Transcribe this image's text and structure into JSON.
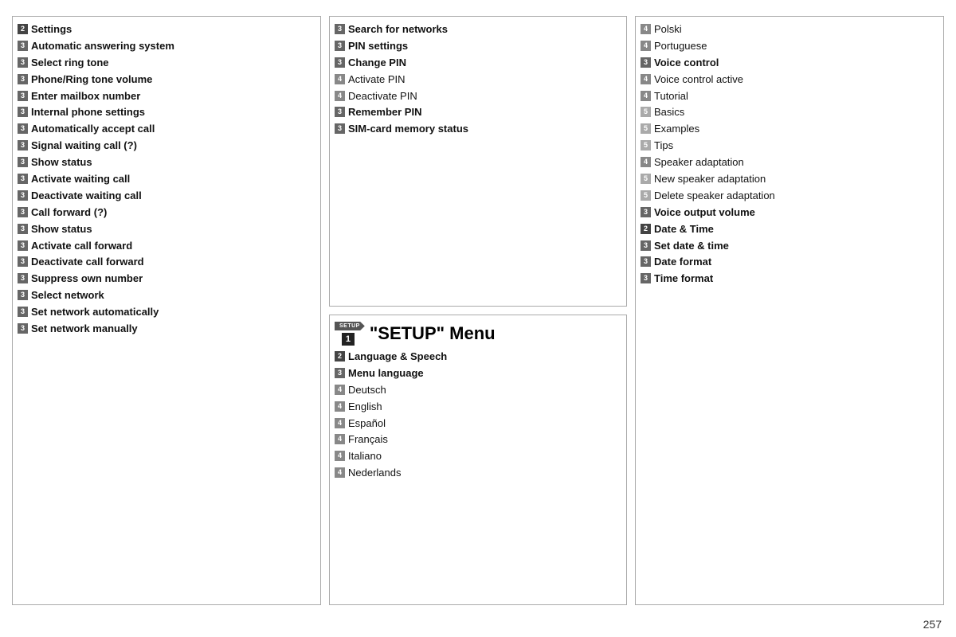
{
  "columns": {
    "left": {
      "items": [
        {
          "badge": "2",
          "level": 2,
          "text": "Settings",
          "bold": true
        },
        {
          "badge": "3",
          "level": 3,
          "text": "Automatic answering system",
          "bold": true
        },
        {
          "badge": "3",
          "level": 3,
          "text": "Select ring tone",
          "bold": true
        },
        {
          "badge": "3",
          "level": 3,
          "text": "Phone/Ring tone volume",
          "bold": true
        },
        {
          "badge": "3",
          "level": 3,
          "text": "Enter mailbox number",
          "bold": true
        },
        {
          "badge": "3",
          "level": 3,
          "text": "Internal phone settings",
          "bold": true
        },
        {
          "badge": "3",
          "level": 3,
          "text": "Automatically accept call",
          "bold": true
        },
        {
          "badge": "3",
          "level": 3,
          "text": "Signal waiting call (?)",
          "bold": true
        },
        {
          "badge": "3",
          "level": 3,
          "text": "Show status",
          "bold": true
        },
        {
          "badge": "3",
          "level": 3,
          "text": "Activate waiting call",
          "bold": true
        },
        {
          "badge": "3",
          "level": 3,
          "text": "Deactivate waiting call",
          "bold": true
        },
        {
          "badge": "3",
          "level": 3,
          "text": "Call forward (?)",
          "bold": true
        },
        {
          "badge": "3",
          "level": 3,
          "text": "Show status",
          "bold": true
        },
        {
          "badge": "3",
          "level": 3,
          "text": "Activate call forward",
          "bold": true
        },
        {
          "badge": "3",
          "level": 3,
          "text": "Deactivate call forward",
          "bold": true
        },
        {
          "badge": "3",
          "level": 3,
          "text": "Suppress own number",
          "bold": true
        },
        {
          "badge": "3",
          "level": 3,
          "text": "Select network",
          "bold": true
        },
        {
          "badge": "3",
          "level": 3,
          "text": "Set network automatically",
          "bold": true
        },
        {
          "badge": "3",
          "level": 3,
          "text": "Set network manually",
          "bold": true
        }
      ]
    },
    "middle_upper": {
      "items": [
        {
          "badge": "3",
          "level": 3,
          "text": "Search for networks",
          "bold": true
        },
        {
          "badge": "3",
          "level": 3,
          "text": "PIN settings",
          "bold": true
        },
        {
          "badge": "3",
          "level": 3,
          "text": "Change PIN",
          "bold": true
        },
        {
          "badge": "4",
          "level": 4,
          "text": "Activate PIN",
          "bold": false
        },
        {
          "badge": "4",
          "level": 4,
          "text": "Deactivate PIN",
          "bold": false
        },
        {
          "badge": "3",
          "level": 3,
          "text": "Remember PIN",
          "bold": true
        },
        {
          "badge": "3",
          "level": 3,
          "text": "SIM-card memory status",
          "bold": true
        }
      ]
    },
    "middle_lower": {
      "setup_icon": "SETUP",
      "setup_badge": "1",
      "setup_title": "\"SETUP\" Menu",
      "items": [
        {
          "badge": "2",
          "level": 2,
          "text": "Language & Speech",
          "bold": true
        },
        {
          "badge": "3",
          "level": 3,
          "text": "Menu language",
          "bold": true
        },
        {
          "badge": "4",
          "level": 4,
          "text": "Deutsch",
          "bold": false
        },
        {
          "badge": "4",
          "level": 4,
          "text": "English",
          "bold": false
        },
        {
          "badge": "4",
          "level": 4,
          "text": "Español",
          "bold": false
        },
        {
          "badge": "4",
          "level": 4,
          "text": "Français",
          "bold": false
        },
        {
          "badge": "4",
          "level": 4,
          "text": "Italiano",
          "bold": false
        },
        {
          "badge": "4",
          "level": 4,
          "text": "Nederlands",
          "bold": false
        }
      ]
    },
    "right": {
      "items": [
        {
          "badge": "4",
          "level": 4,
          "text": "Polski",
          "bold": false
        },
        {
          "badge": "4",
          "level": 4,
          "text": "Portuguese",
          "bold": false
        },
        {
          "badge": "3",
          "level": 3,
          "text": "Voice control",
          "bold": true
        },
        {
          "badge": "4",
          "level": 4,
          "text": "Voice control active",
          "bold": false
        },
        {
          "badge": "4",
          "level": 4,
          "text": "Tutorial",
          "bold": false
        },
        {
          "badge": "5",
          "level": 5,
          "text": "Basics",
          "bold": false
        },
        {
          "badge": "5",
          "level": 5,
          "text": "Examples",
          "bold": false
        },
        {
          "badge": "5",
          "level": 5,
          "text": "Tips",
          "bold": false
        },
        {
          "badge": "4",
          "level": 4,
          "text": "Speaker adaptation",
          "bold": false
        },
        {
          "badge": "5",
          "level": 5,
          "text": "New speaker adaptation",
          "bold": false
        },
        {
          "badge": "5",
          "level": 5,
          "text": "Delete speaker adaptation",
          "bold": false
        },
        {
          "badge": "3",
          "level": 3,
          "text": "Voice output volume",
          "bold": true
        },
        {
          "badge": "2",
          "level": 2,
          "text": "Date & Time",
          "bold": true
        },
        {
          "badge": "3",
          "level": 3,
          "text": "Set date & time",
          "bold": true
        },
        {
          "badge": "3",
          "level": 3,
          "text": "Date format",
          "bold": true
        },
        {
          "badge": "3",
          "level": 3,
          "text": "Time format",
          "bold": true
        }
      ]
    }
  },
  "page_number": "257"
}
